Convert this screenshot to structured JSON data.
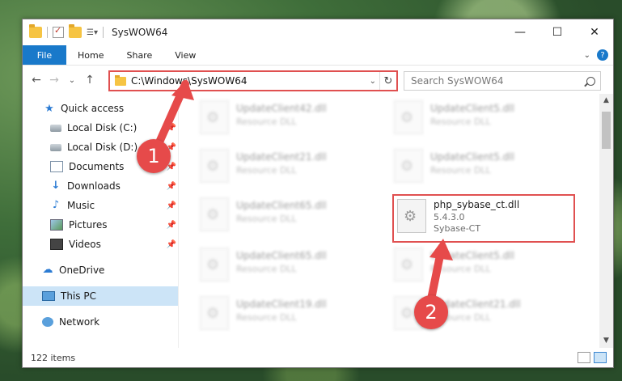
{
  "window": {
    "title": "SysWOW64",
    "controls": {
      "minimize": "—",
      "maximize": "☐",
      "close": "✕"
    }
  },
  "ribbon": {
    "tabs": [
      "File",
      "Home",
      "Share",
      "View"
    ],
    "help": "?"
  },
  "nav": {
    "back": "←",
    "forward": "→",
    "recent": "⌄",
    "up": "↑",
    "address": "C:\\Windows\\SysWOW64",
    "refresh": "↻",
    "search_placeholder": "Search SysWOW64"
  },
  "sidebar": {
    "items": [
      {
        "label": "Quick access",
        "icon": "star-icon",
        "pinned": false
      },
      {
        "label": "Local Disk (C:)",
        "icon": "drive-icon",
        "pinned": true
      },
      {
        "label": "Local Disk (D:)",
        "icon": "drive-icon",
        "pinned": true
      },
      {
        "label": "Documents",
        "icon": "documents-icon",
        "pinned": true
      },
      {
        "label": "Downloads",
        "icon": "download-icon",
        "pinned": true
      },
      {
        "label": "Music",
        "icon": "music-icon",
        "pinned": true
      },
      {
        "label": "Pictures",
        "icon": "pictures-icon",
        "pinned": true
      },
      {
        "label": "Videos",
        "icon": "videos-icon",
        "pinned": true
      },
      {
        "label": "OneDrive",
        "icon": "cloud-icon",
        "pinned": false
      },
      {
        "label": "This PC",
        "icon": "computer-icon",
        "pinned": false,
        "selected": true
      },
      {
        "label": "Network",
        "icon": "network-icon",
        "pinned": false
      }
    ]
  },
  "files": [
    {
      "name": "UpdateClient42.dll",
      "sub": "Resource DLL",
      "blurred": true
    },
    {
      "name": "UpdateClient5.dll",
      "sub": "Resource DLL",
      "blurred": true
    },
    {
      "name": "UpdateClient21.dll",
      "sub": "Resource DLL",
      "blurred": true
    },
    {
      "name": "UpdateClient5.dll",
      "sub": "Resource DLL",
      "blurred": true
    },
    {
      "name": "UpdateClient65.dll",
      "sub": "Resource DLL",
      "blurred": true
    },
    {
      "name": "php_sybase_ct.dll",
      "version": "5.4.3.0",
      "sub": "Sybase-CT",
      "blurred": false,
      "highlighted": true
    },
    {
      "name": "UpdateClient5.dll",
      "sub": "Resource DLL",
      "blurred": true
    },
    {
      "name": "UpdateClient65.dll",
      "sub": "Resource DLL",
      "blurred": true
    },
    {
      "name": "UpdateClient19.dll",
      "sub": "Resource DLL",
      "blurred": true
    },
    {
      "name": "UpdateClient21.dll",
      "sub": "Resource DLL",
      "blurred": true
    }
  ],
  "status": {
    "items": "122 items"
  },
  "annotations": {
    "step1": "1",
    "step2": "2",
    "color": "#e64a4a"
  }
}
